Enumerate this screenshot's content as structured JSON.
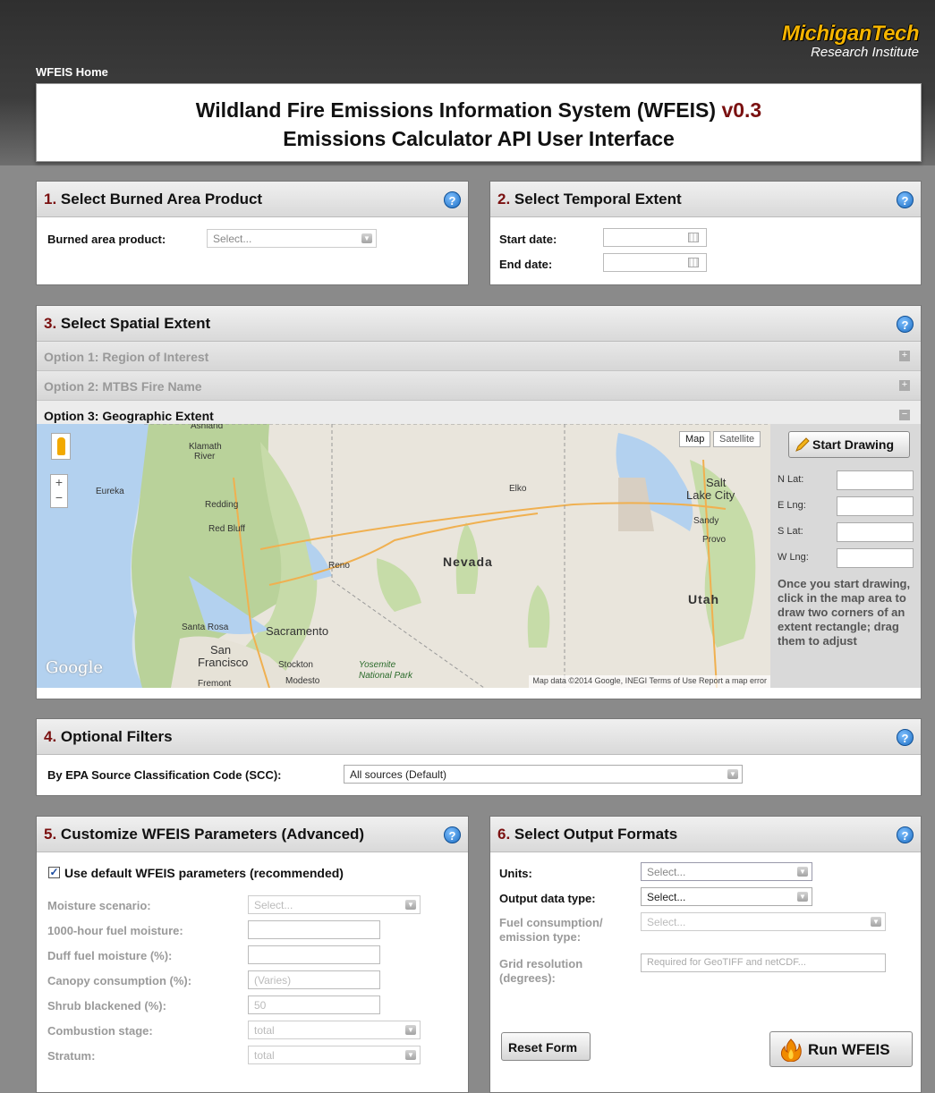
{
  "header": {
    "home_link": "WFEIS Home",
    "logo_main": "MichiganTech",
    "logo_sub": "Research Institute",
    "title_main": "Wildland Fire Emissions Information System (WFEIS)",
    "title_version": "v0.3",
    "subtitle": "Emissions Calculator API User Interface"
  },
  "section1": {
    "num": "1.",
    "title": "Select Burned Area Product",
    "product_label": "Burned area product:",
    "product_value": "Select..."
  },
  "section2": {
    "num": "2.",
    "title": "Select Temporal Extent",
    "start_label": "Start date:",
    "end_label": "End date:"
  },
  "section3": {
    "num": "3.",
    "title": "Select Spatial Extent",
    "option1": "Option 1: Region of Interest",
    "option2": "Option 2: MTBS Fire Name",
    "option3": "Option 3: Geographic Extent",
    "map": {
      "type_map": "Map",
      "type_satellite": "Satellite",
      "labels": {
        "ashland": "Ashland",
        "klamath": "Klamath",
        "river": "River",
        "eureka": "Eureka",
        "redding": "Redding",
        "red_bluff": "Red Bluff",
        "reno": "Reno",
        "nevada": "Nevada",
        "elko": "Elko",
        "salt": "Salt",
        "lake_city": "Lake City",
        "sandy": "Sandy",
        "provo": "Provo",
        "utah": "Utah",
        "santa_rosa": "Santa Rosa",
        "sacramento": "Sacramento",
        "san": "San",
        "francisco": "Francisco",
        "stockton": "Stockton",
        "modesto": "Modesto",
        "fremont": "Fremont",
        "yosemite": "Yosemite",
        "national_park": "National Park"
      },
      "google": "Google",
      "footer": "Map data ©2014 Google, INEGI   Terms of Use   Report a map error"
    },
    "start_drawing": "Start Drawing",
    "n_lat": "N Lat:",
    "e_lng": "E Lng:",
    "s_lat": "S Lat:",
    "w_lng": "W Lng:",
    "help_text": "Once you start drawing, click in the map area to draw two corners of an extent rectangle; drag them to adjust"
  },
  "section4": {
    "num": "4.",
    "title": "Optional Filters",
    "scc_label": "By EPA Source Classification Code (SCC):",
    "scc_value": "All sources (Default)"
  },
  "section5": {
    "num": "5.",
    "title": "Customize WFEIS Parameters (Advanced)",
    "use_default": "Use default WFEIS parameters (recommended)",
    "moisture_label": "Moisture scenario:",
    "moisture_value": "Select...",
    "fuel1000_label": "1000-hour fuel moisture:",
    "duff_label": "Duff fuel moisture (%):",
    "canopy_label": "Canopy consumption (%):",
    "canopy_value": "(Varies)",
    "shrub_label": "Shrub blackened (%):",
    "shrub_value": "50",
    "combustion_label": "Combustion stage:",
    "combustion_value": "total",
    "stratum_label": "Stratum:",
    "stratum_value": "total"
  },
  "section6": {
    "num": "6.",
    "title": "Select Output Formats",
    "units_label": "Units:",
    "units_value": "Select...",
    "output_type_label": "Output data type:",
    "output_type_value": "Select...",
    "fuel_label_1": "Fuel consumption/",
    "fuel_label_2": "emission type:",
    "fuel_value": "Select...",
    "grid_label_1": "Grid resolution",
    "grid_label_2": "(degrees):",
    "grid_placeholder": "Required for GeoTIFF and netCDF...",
    "reset": "Reset Form",
    "run": "Run WFEIS"
  },
  "help_glyph": "?",
  "plus": "+",
  "minus": "−"
}
